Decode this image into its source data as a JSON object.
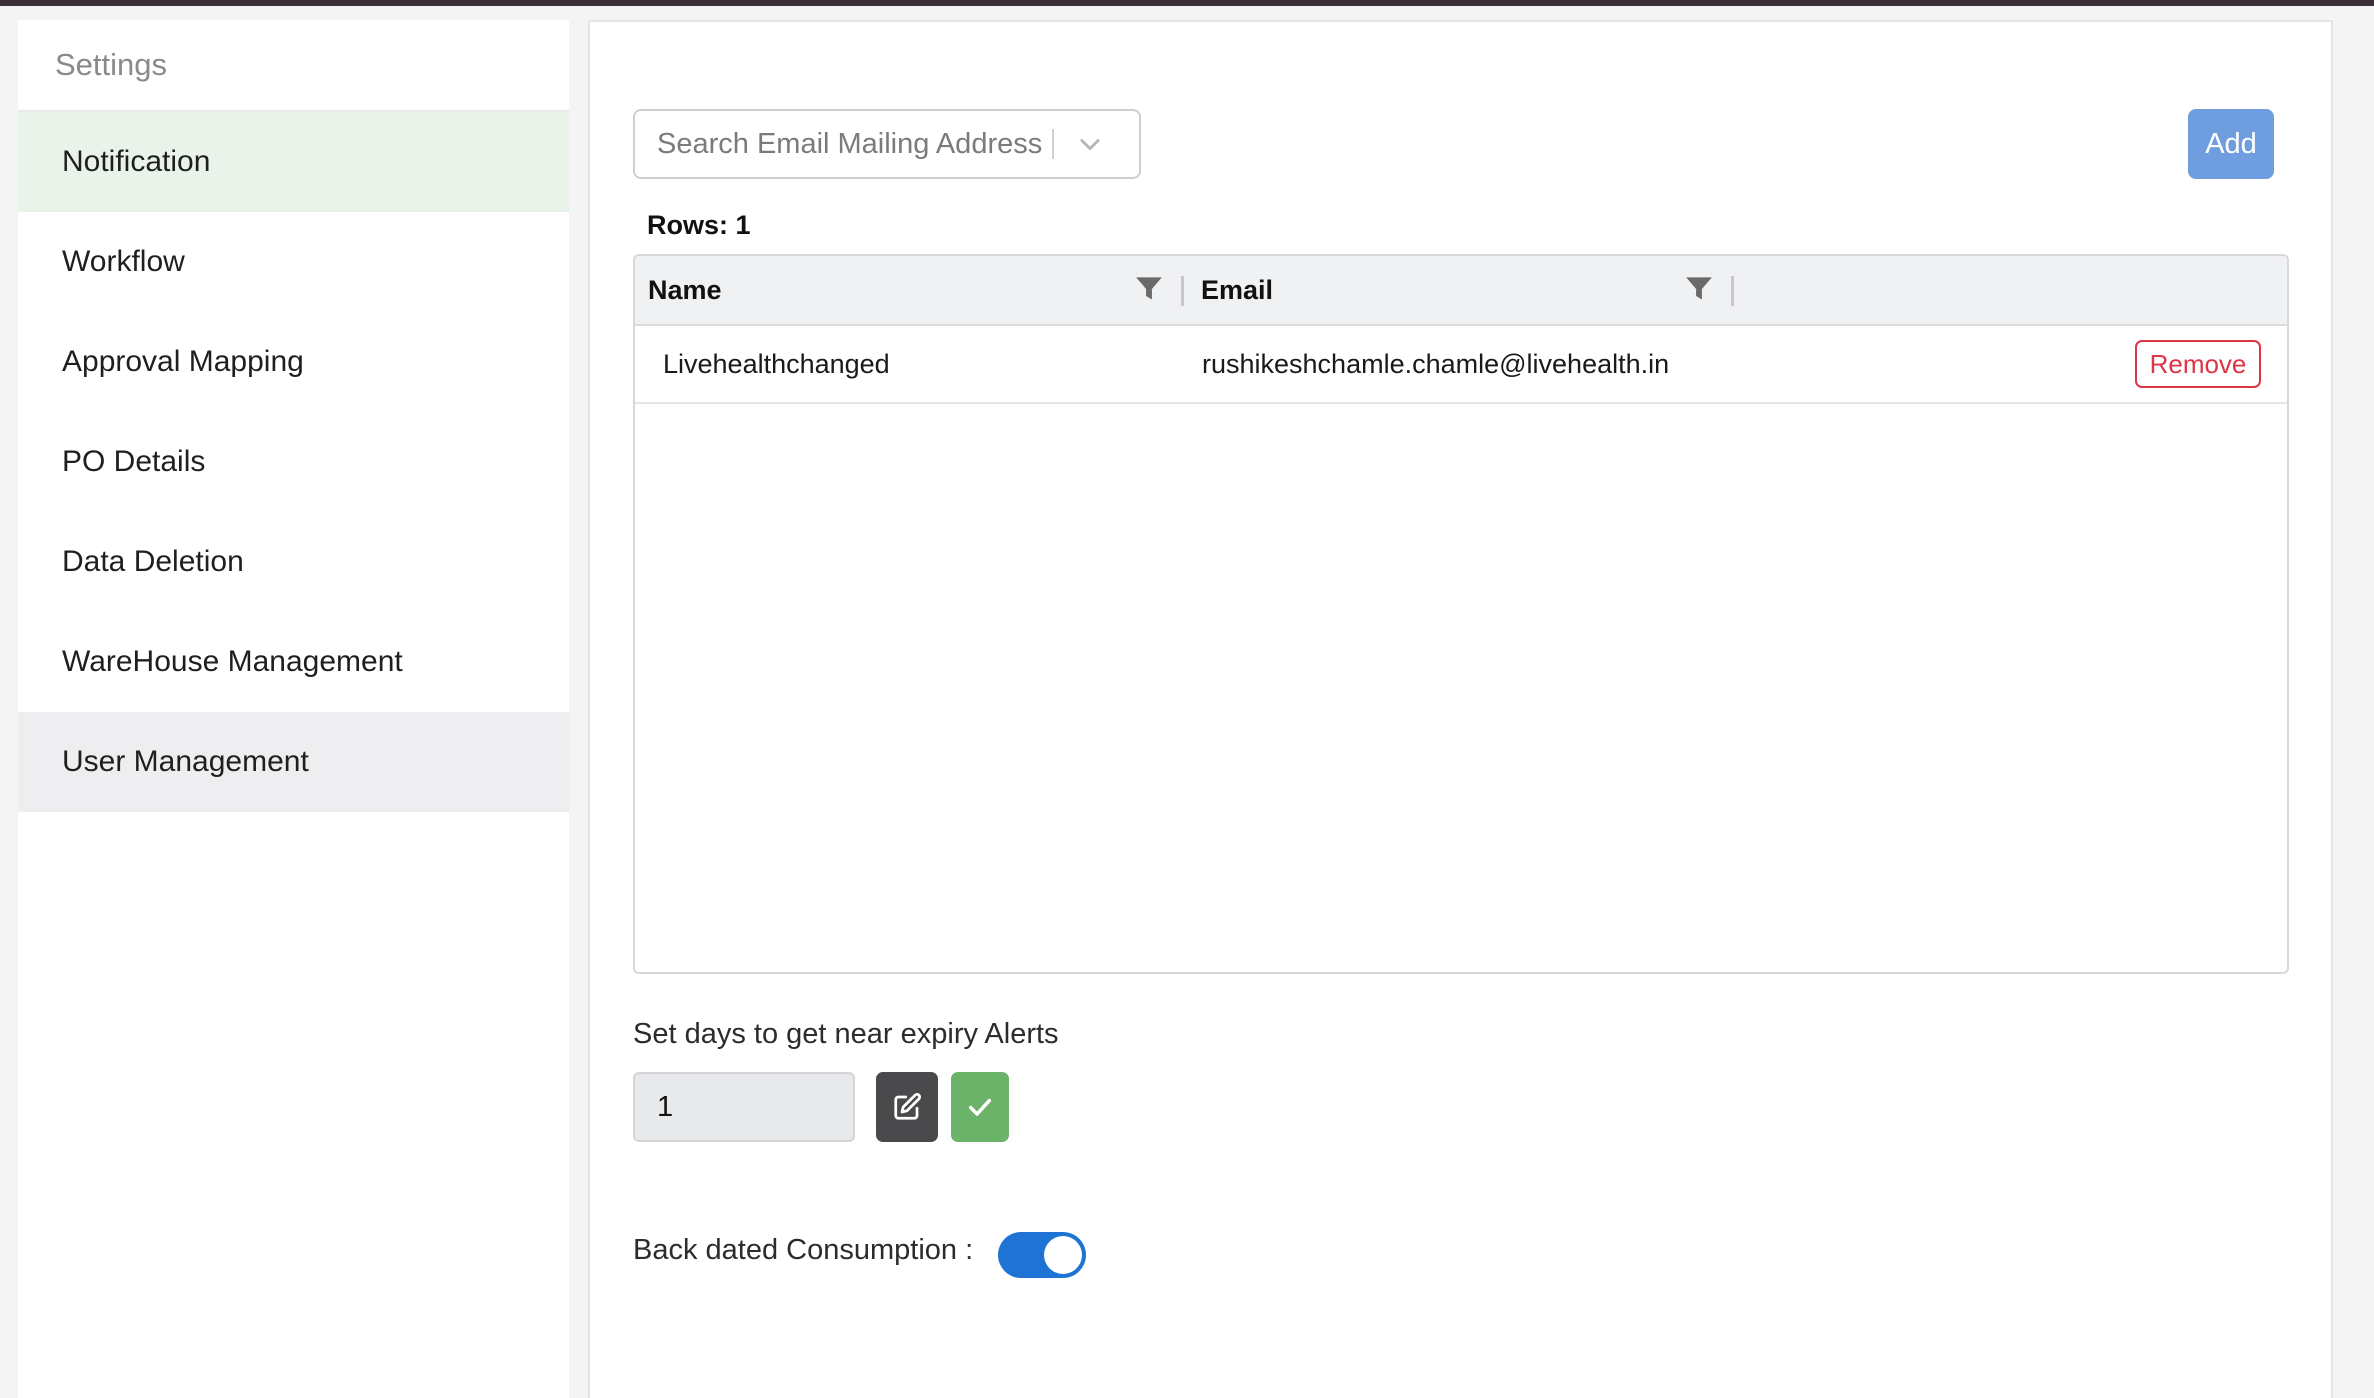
{
  "sidebar": {
    "header": "Settings",
    "items": [
      {
        "label": "Notification",
        "state": "active"
      },
      {
        "label": "Workflow"
      },
      {
        "label": "Approval Mapping"
      },
      {
        "label": "PO Details"
      },
      {
        "label": "Data Deletion"
      },
      {
        "label": "WareHouse Management"
      },
      {
        "label": "User Management",
        "state": "hover"
      }
    ]
  },
  "search": {
    "placeholder": "Search Email Mailing Address",
    "icon": "chevron-down-icon"
  },
  "toolbar": {
    "add_label": "Add"
  },
  "table": {
    "rows_label": "Rows: 1",
    "columns": [
      "Name",
      "Email"
    ],
    "filter_icon": "filter-icon",
    "rows": [
      {
        "name": "Livehealthchanged",
        "email": "rushikeshchamle.chamle@livehealth.in",
        "action": "Remove"
      }
    ]
  },
  "expiry": {
    "label": "Set days to get near expiry Alerts",
    "value": "1",
    "edit_icon": "edit-icon",
    "confirm_icon": "check-icon"
  },
  "backdated": {
    "label": "Back dated Consumption :",
    "enabled": true
  },
  "colors": {
    "active_bg": "#e9f3ea",
    "add_button": "#6e9ee0",
    "remove": "#dc3545",
    "edit_button": "#4a4a4d",
    "confirm_button": "#6cb36a",
    "toggle_on": "#1f73d4"
  }
}
